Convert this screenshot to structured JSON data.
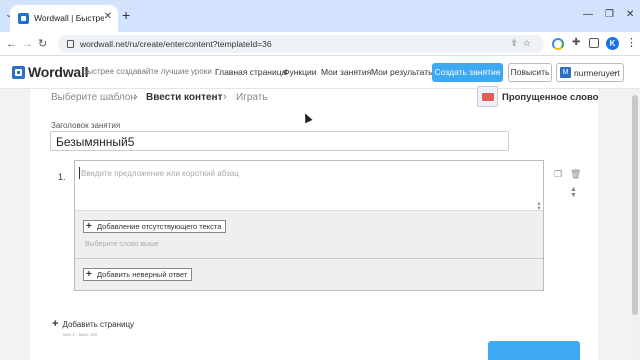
{
  "browser": {
    "tab_title": "Wordwall | Быстрее создавайте",
    "url": "wordwall.net/ru/create/entercontent?templateId=36",
    "profile_initial": "K"
  },
  "header": {
    "logo": "Wordwall",
    "tagline": "Быстрее создавайте лучшие уроки",
    "nav": [
      "Главная страница",
      "Функции",
      "Мои занятия",
      "Мои результаты"
    ],
    "create_button": "Создать занятие",
    "upgrade_button": "Повысить",
    "user_initial": "M",
    "user_name": "nurmeruyert"
  },
  "steps": {
    "step1": "Выберите шаблон",
    "step2": "Ввести контент",
    "step3": "Играть",
    "separator": "›"
  },
  "template": {
    "name": "Пропущенное слово"
  },
  "activity": {
    "title_label": "Заголовок занятия",
    "title_value": "Безымянный5"
  },
  "question": {
    "number": "1.",
    "placeholder": "Введите предложение или короткий абзац",
    "add_missing_text": "Добавление отсутствующего текста",
    "choose_word_hint": "Выберите слово выше",
    "add_wrong_answer": "Добавить неверный ответ"
  },
  "footer": {
    "add_page": "Добавить страницу",
    "limits": "мин 1 · макс 100"
  },
  "colors": {
    "accent": "#3da9f2",
    "tab_bar": "#d3e3fd"
  }
}
